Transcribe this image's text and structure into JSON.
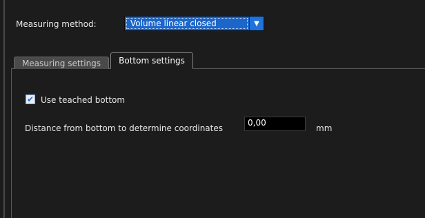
{
  "measuring": {
    "label": "Measuring method:",
    "selected_value": "Volume linear closed",
    "dropdown_icon": "chevron-down-icon"
  },
  "tabs": [
    {
      "label": "Measuring settings",
      "active": false
    },
    {
      "label": "Bottom settings",
      "active": true
    }
  ],
  "bottom_settings": {
    "use_teached_bottom": {
      "label": "Use teached bottom",
      "checked": true
    },
    "distance": {
      "label": "Distance from bottom to determine coordinates",
      "value": "0,00",
      "unit": "mm"
    }
  },
  "colors": {
    "background": "#1c1c1c",
    "accent": "#1b66c8",
    "text": "#e8e8e8"
  }
}
